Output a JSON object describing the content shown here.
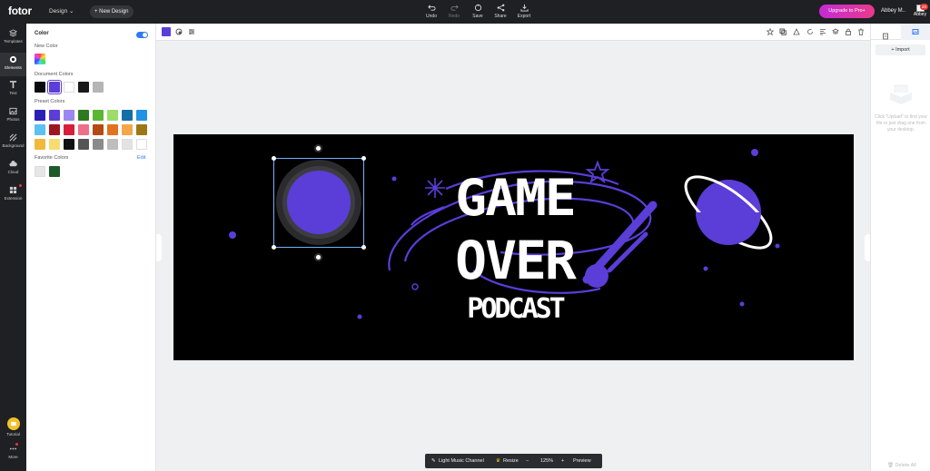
{
  "app": {
    "logo": "fotor",
    "design_menu": "Design",
    "new_design": "+ New Design"
  },
  "toolbar": {
    "undo": "Undo",
    "redo": "Redo",
    "save": "Save",
    "share": "Share",
    "export": "Export"
  },
  "account": {
    "upgrade": "Upgrade to Pro+",
    "user_name": "Abbey M..",
    "avatar_name": "Abbey",
    "notifications": "20"
  },
  "rail": {
    "items": [
      "Templates",
      "Elements",
      "Text",
      "Photos",
      "Background",
      "Cloud",
      "Extension"
    ],
    "tutorial": "Tutorial",
    "more": "More"
  },
  "color_panel": {
    "title": "Color",
    "new_color": "New Color",
    "document_colors_label": "Document Colors",
    "document_colors": [
      "#0a0a0a",
      "#5b3dd8",
      "#ffffff",
      "#1a1a1a",
      "#b5b5b5"
    ],
    "preset_colors_label": "Preset Colors",
    "preset_colors": [
      "#2b1fb6",
      "#5b3dd8",
      "#9b87f0",
      "#2f7a1f",
      "#5bb633",
      "#9bdc6a",
      "#136fa8",
      "#1f94e6",
      "#5cc1f0",
      "#9e1622",
      "#d81e3c",
      "#ef6f8b",
      "#b54b12",
      "#e2721f",
      "#f4a64a",
      "#9c7716",
      "#f0b93a",
      "#f6dd6f",
      "#111111",
      "#555555",
      "#8a8a8a",
      "#bdbdbd",
      "#e3e3e3",
      "#ffffff"
    ],
    "favorite_colors_label": "Favorite Colors",
    "favorite_edit": "Edit",
    "favorite_colors": [
      "#e6e6e6",
      "#1d5a2a"
    ]
  },
  "banner": {
    "line1": "GAME",
    "line2": "OVER",
    "line3": "PODCAST"
  },
  "bottom_bar": {
    "channel": "Light Music Channel",
    "resize": "Resize",
    "zoom": "125%",
    "preview": "Preview"
  },
  "right_panel": {
    "import": "+ Import",
    "hint": "Click \"Upload\" to find your file or just drag one from your desktop.",
    "delete_all": "Delete All"
  }
}
